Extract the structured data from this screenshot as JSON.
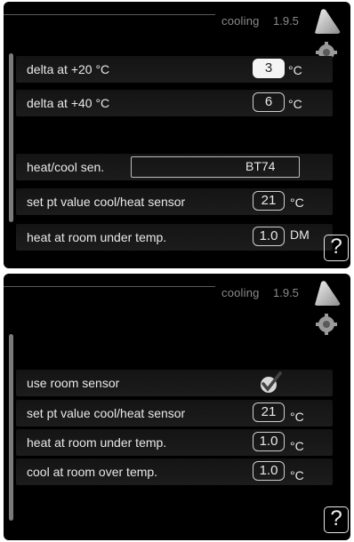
{
  "screens": [
    {
      "menu_title": "cooling",
      "menu_number": "1.9.5",
      "rows": [
        {
          "label": "delta at +20 °C",
          "value": "3",
          "unit": "°C"
        },
        {
          "label": "delta at +40 °C",
          "value": "6",
          "unit": "°C"
        },
        {
          "label": "heat/cool sen.",
          "value": "BT74"
        },
        {
          "label": "set pt value cool/heat sensor",
          "value": "21",
          "unit": "°C"
        },
        {
          "label": "heat at room under temp.",
          "value": "1.0",
          "unit": "DM"
        }
      ],
      "help": "?"
    },
    {
      "menu_title": "cooling",
      "menu_number": "1.9.5",
      "rows": [
        {
          "label": "use room sensor",
          "checked": true
        },
        {
          "label": "set pt value cool/heat sensor",
          "value": "21",
          "unit": "°C"
        },
        {
          "label": "heat at room under temp.",
          "value": "1.0",
          "unit": "°C"
        },
        {
          "label": "cool at room over temp.",
          "value": "1.0",
          "unit": "°C"
        }
      ],
      "help": "?"
    }
  ],
  "icons": {
    "house": "house-icon",
    "gear": "gear-icon",
    "help": "help-icon",
    "check": "checkmark-icon"
  }
}
